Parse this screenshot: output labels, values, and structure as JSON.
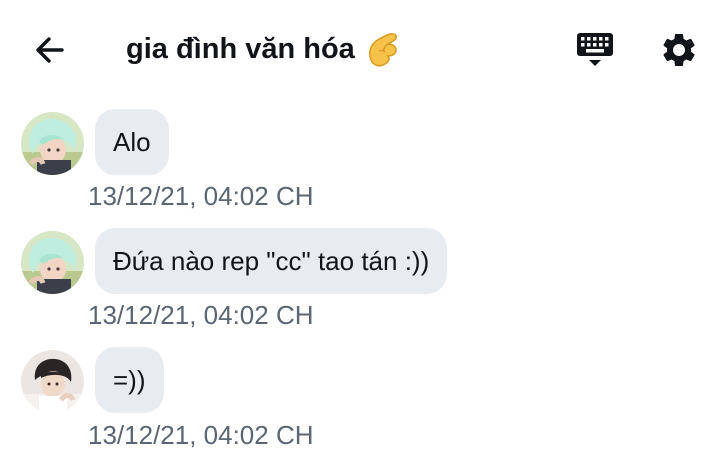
{
  "header": {
    "title": "gia đình văn hóa",
    "back_icon": "arrow-left-icon",
    "title_emoji_icon": "pinching-hand-icon",
    "keyboard_icon": "keyboard-icon",
    "settings_icon": "gear-icon"
  },
  "messages": [
    {
      "avatar": "avatar-mint-hair",
      "text": "Alo",
      "time": "13/12/21, 04:02 CH"
    },
    {
      "avatar": "avatar-mint-hair",
      "text": "Đứa nào rep \"cc\" tao tán :))",
      "time": "13/12/21, 04:02 CH"
    },
    {
      "avatar": "avatar-dark-hair",
      "text": "=))",
      "time": "13/12/21, 04:02 CH"
    }
  ],
  "colors": {
    "bubble_background": "#e8ecf1",
    "timestamp": "#5b6573",
    "text": "#111418"
  }
}
